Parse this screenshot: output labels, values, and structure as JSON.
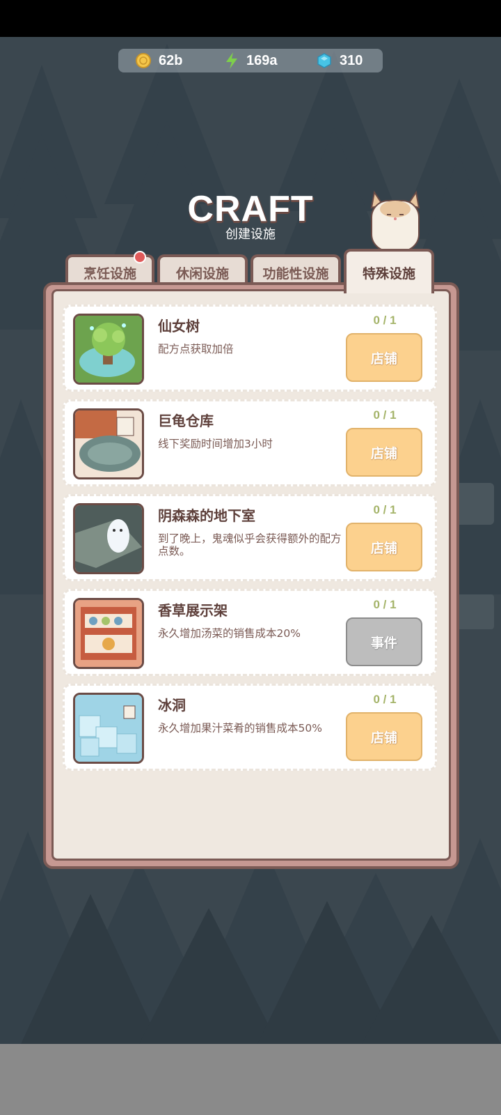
{
  "resources": [
    {
      "icon": "coin-icon",
      "value": "62b"
    },
    {
      "icon": "lightning-icon",
      "value": "169a"
    },
    {
      "icon": "gem-icon",
      "value": "310"
    }
  ],
  "header": {
    "title": "CRAFT",
    "subtitle": "创建设施"
  },
  "tabs": [
    {
      "label": "烹饪设施",
      "active": false,
      "notification": true
    },
    {
      "label": "休闲设施",
      "active": false
    },
    {
      "label": "功能性设施",
      "active": false
    },
    {
      "label": "特殊设施",
      "active": true
    }
  ],
  "items": [
    {
      "name": "仙女树",
      "desc": "配方点获取加倍",
      "count": "0 / 1",
      "button": "店铺"
    },
    {
      "name": "巨龟仓库",
      "desc": "线下奖励时间增加3小时",
      "count": "0 / 1",
      "button": "店铺"
    },
    {
      "name": "阴森森的地下室",
      "desc": "到了晚上，鬼魂似乎会获得额外的配方点数。",
      "count": "0 / 1",
      "button": "店铺"
    },
    {
      "name": "香草展示架",
      "desc": "永久增加汤菜的销售成本20%",
      "count": "0 / 1",
      "button": "事件"
    },
    {
      "name": "冰洞",
      "desc": "永久增加果汁菜肴的销售成本50%",
      "count": "0 / 1",
      "button": "店铺"
    }
  ],
  "colors": {
    "shop_button": "#fcd18e",
    "event_button": "#bdbdbd",
    "accent": "#e05a5a"
  }
}
